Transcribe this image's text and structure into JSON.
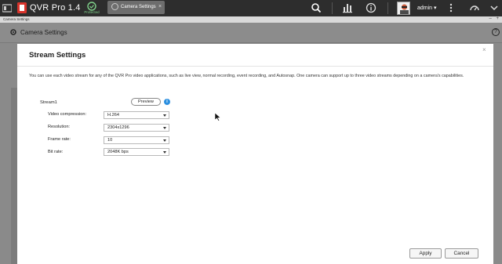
{
  "topbar": {
    "app_title": "QVR Pro 1.4",
    "protected_label": "Protected",
    "tab_label": "Camera Settings",
    "user_label": "admin ▾"
  },
  "substrip": {
    "label": "Camera Settings"
  },
  "background_page": {
    "title": "Camera Settings",
    "help_label": "?"
  },
  "modal": {
    "title": "Stream Settings",
    "close_label": "×",
    "description": "You can use each video stream for any of the QVR Pro video applications, such as live view, normal recording, event recording, and Autosnap. One camera can support up to three video streams depending on a camera's capabilities.",
    "stream_label": "Stream1",
    "preview_label": "Preview",
    "info_label": "i",
    "fields": [
      {
        "label": "Video compression:",
        "value": "H.264"
      },
      {
        "label": "Resolution:",
        "value": "2304x1296"
      },
      {
        "label": "Frame rate:",
        "value": "10"
      },
      {
        "label": "Bit rate:",
        "value": "2048K bps"
      }
    ],
    "apply_label": "Apply",
    "cancel_label": "Cancel"
  },
  "colors": {
    "topbar_bg": "#2d2d2d",
    "info_blue": "#2b8fe0",
    "protected_green": "#7fd08a",
    "modal_bg": "#ffffff"
  }
}
